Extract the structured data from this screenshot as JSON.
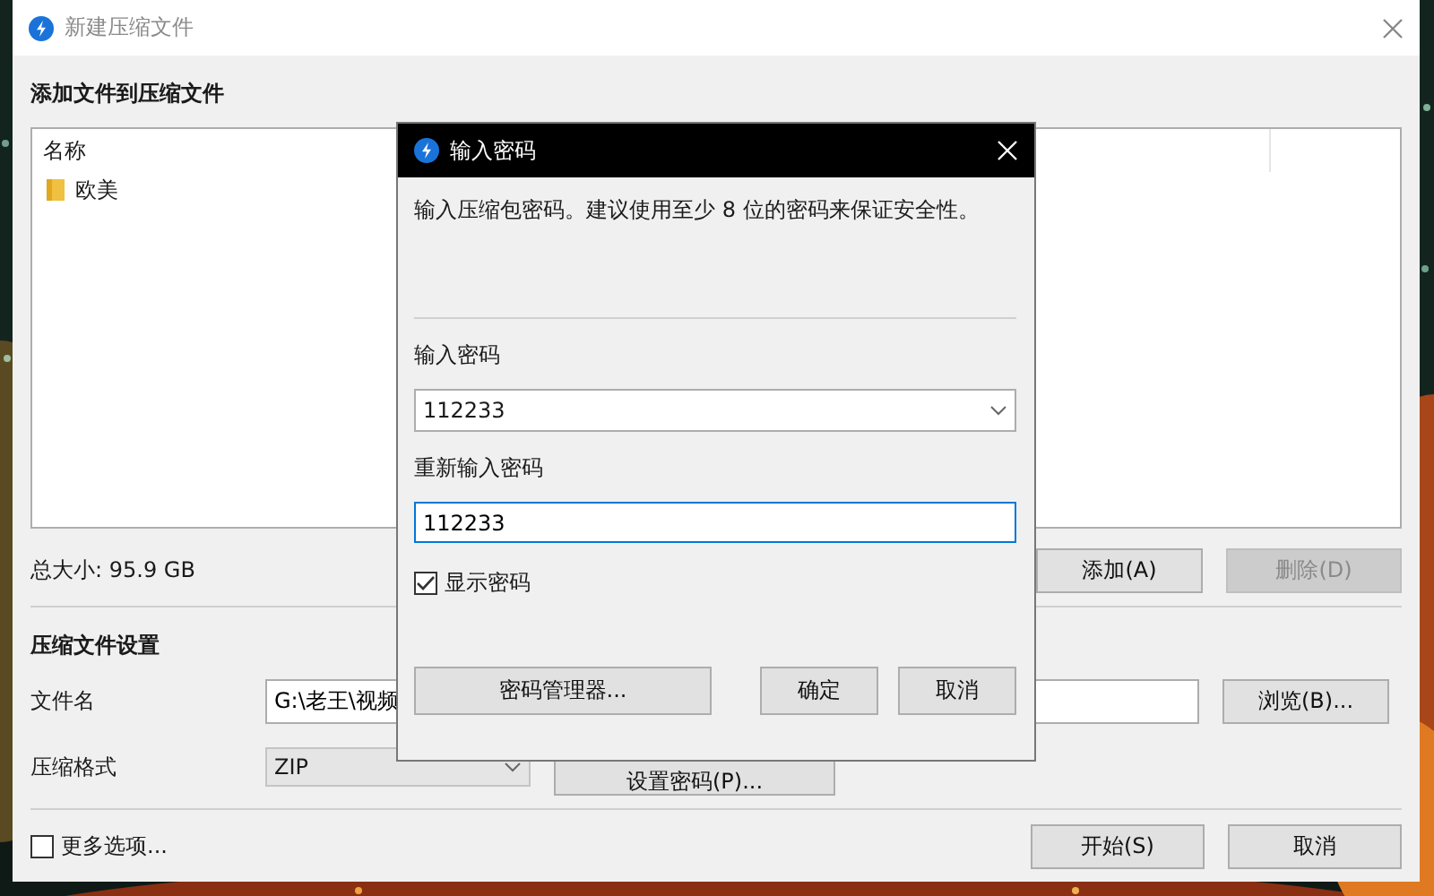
{
  "window": {
    "title": "新建压缩文件",
    "active": false
  },
  "files": {
    "heading": "添加文件到压缩文件",
    "columns": [
      "名称"
    ],
    "rows": [
      {
        "name": "欧美",
        "kind": "folder"
      }
    ]
  },
  "total_size": "总大小: 95.9 GB",
  "file_buttons": [
    {
      "label": "添加(A)",
      "disabled": false
    },
    {
      "label": "删除(D)",
      "disabled": true
    }
  ],
  "settings": {
    "heading": "压缩文件设置",
    "filename_label": "文件名",
    "filename_value": "G:\\老王\\视频",
    "browse_button": "浏览(B)...",
    "format_label": "压缩格式",
    "format_value": "ZIP",
    "password_button": "设置密码(P)..."
  },
  "more_options": {
    "label": "更多选项...",
    "checked": false
  },
  "actions": [
    "开始(S)",
    "取消"
  ],
  "dialog": {
    "title": "输入密码",
    "active": true,
    "description": "输入压缩包密码。建议使用至少 8 位的密码来保证安全性。",
    "password_label": "输入密码",
    "password_value": "112233",
    "confirm_label": "重新输入密码",
    "confirm_value": "112233",
    "show_password": {
      "label": "显示密码",
      "checked": true
    },
    "manager_button": "密码管理器...",
    "buttons": [
      "确定",
      "取消"
    ]
  }
}
